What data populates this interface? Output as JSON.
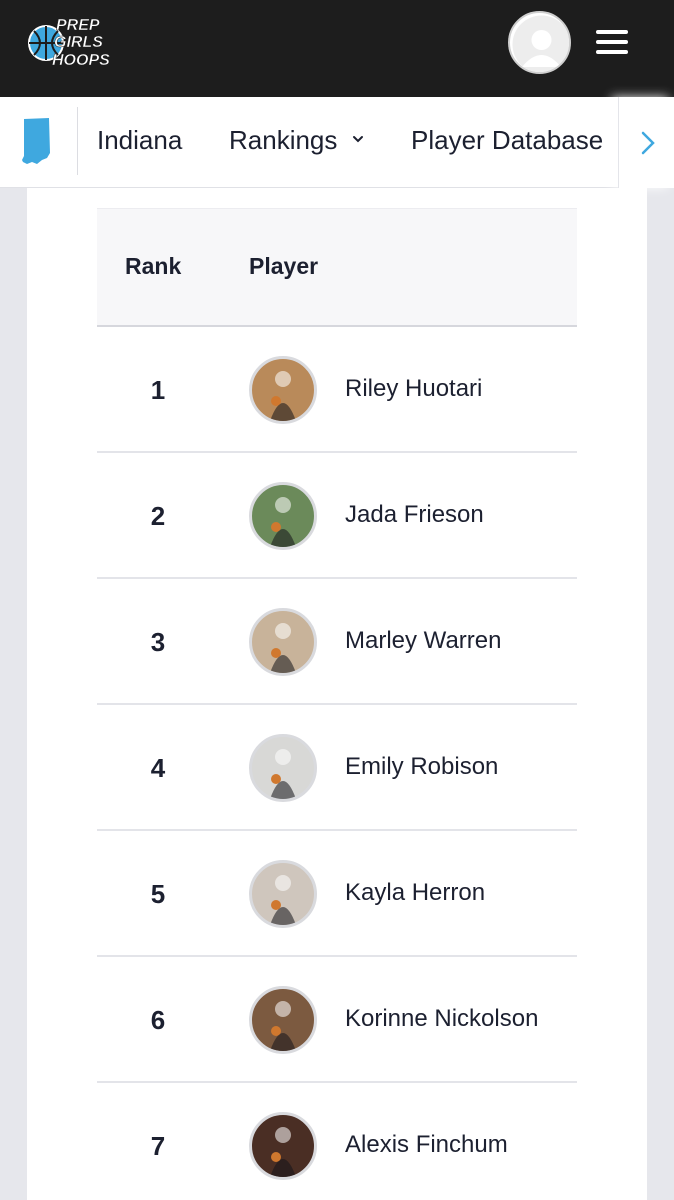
{
  "brand": {
    "logo_lines": [
      "PREP",
      "GIRLS",
      "HOOPS"
    ],
    "accent": "#3fa8df",
    "topbar_bg": "#1d1d1d"
  },
  "subnav": {
    "state_icon": "indiana-state-icon",
    "items": [
      "Indiana",
      "Rankings",
      "Player Database"
    ],
    "scroll_icon": "chevron-right-icon"
  },
  "table": {
    "headers": {
      "rank": "Rank",
      "player": "Player"
    },
    "rows": [
      {
        "rank": "1",
        "name": "Riley Huotari",
        "photo_bg": "#b98a5a"
      },
      {
        "rank": "2",
        "name": "Jada Frieson",
        "photo_bg": "#6b8a5a"
      },
      {
        "rank": "3",
        "name": "Marley Warren",
        "photo_bg": "#c8b39a"
      },
      {
        "rank": "4",
        "name": "Emily Robison",
        "photo_bg": "#d8d8d6"
      },
      {
        "rank": "5",
        "name": "Kayla Herron",
        "photo_bg": "#cfc6bd"
      },
      {
        "rank": "6",
        "name": "Korinne Nickolson",
        "photo_bg": "#7c5a40"
      },
      {
        "rank": "7",
        "name": "Alexis Finchum",
        "photo_bg": "#4a2e24"
      }
    ]
  }
}
